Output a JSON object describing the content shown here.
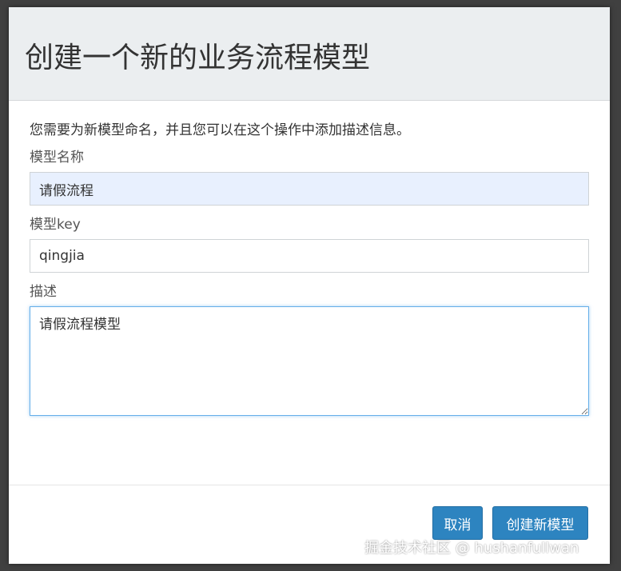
{
  "dialog": {
    "title": "创建一个新的业务流程模型",
    "description": "您需要为新模型命名，并且您可以在这个操作中添加描述信息。"
  },
  "fields": {
    "name": {
      "label": "模型名称",
      "value": "请假流程"
    },
    "key": {
      "label": "模型key",
      "value": "qingjia"
    },
    "description": {
      "label": "描述",
      "value": "请假流程模型"
    }
  },
  "footer": {
    "cancel_label": "取消",
    "create_label": "创建新模型"
  },
  "watermark": "掘金技术社区 @ hushanfullwan",
  "colors": {
    "primary_button": "#2d84c0",
    "header_background": "#ebeef0",
    "focus_border": "#66afe9",
    "autofill_background": "#e8f0fe"
  }
}
